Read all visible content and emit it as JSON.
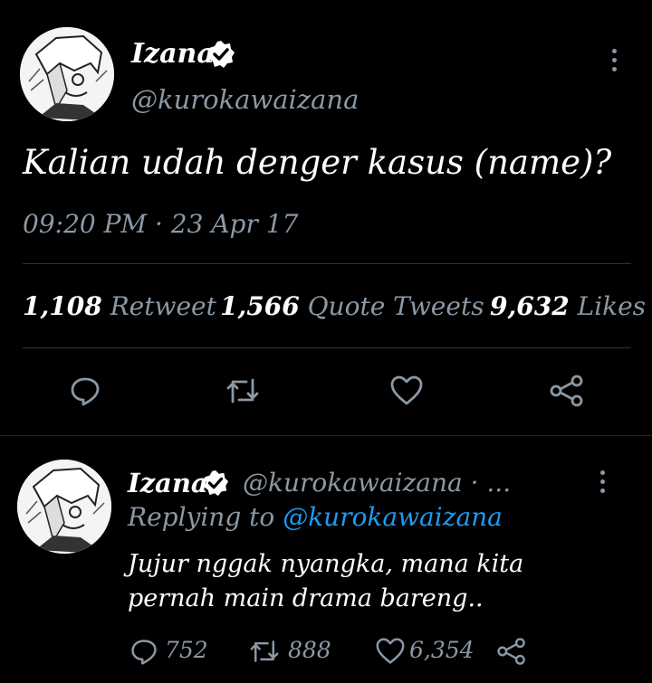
{
  "main_tweet": {
    "display_name": "Izana",
    "handle": "@kurokawaizana",
    "text": "Kalian udah denger kasus (name)?",
    "timestamp": "09:20 PM · 23 Apr 17",
    "stats": {
      "retweets_count": "1,108",
      "retweets_label": "Retweet",
      "quotes_count": "1,566",
      "quotes_label": "Quote Tweets",
      "likes_count": "9,632",
      "likes_label": "Likes"
    }
  },
  "reply_tweet": {
    "display_name": "Izana",
    "handle_time": "@kurokawaizana · ...",
    "replying_prefix": "Replying to",
    "replying_handle": "@kurokawaizana",
    "text_line1": "Jujur nggak nyangka, mana kita",
    "text_line2": "pernah main drama bareng..",
    "reply_count": "752",
    "retweet_count": "888",
    "like_count": "6,354"
  },
  "colors": {
    "background": "#000000",
    "muted": "#8b98a5",
    "link": "#1d9bf0",
    "divider": "#2f3336"
  },
  "icons": [
    "verified-badge-icon",
    "more-options-icon",
    "reply-icon",
    "retweet-icon",
    "like-icon",
    "share-icon"
  ]
}
